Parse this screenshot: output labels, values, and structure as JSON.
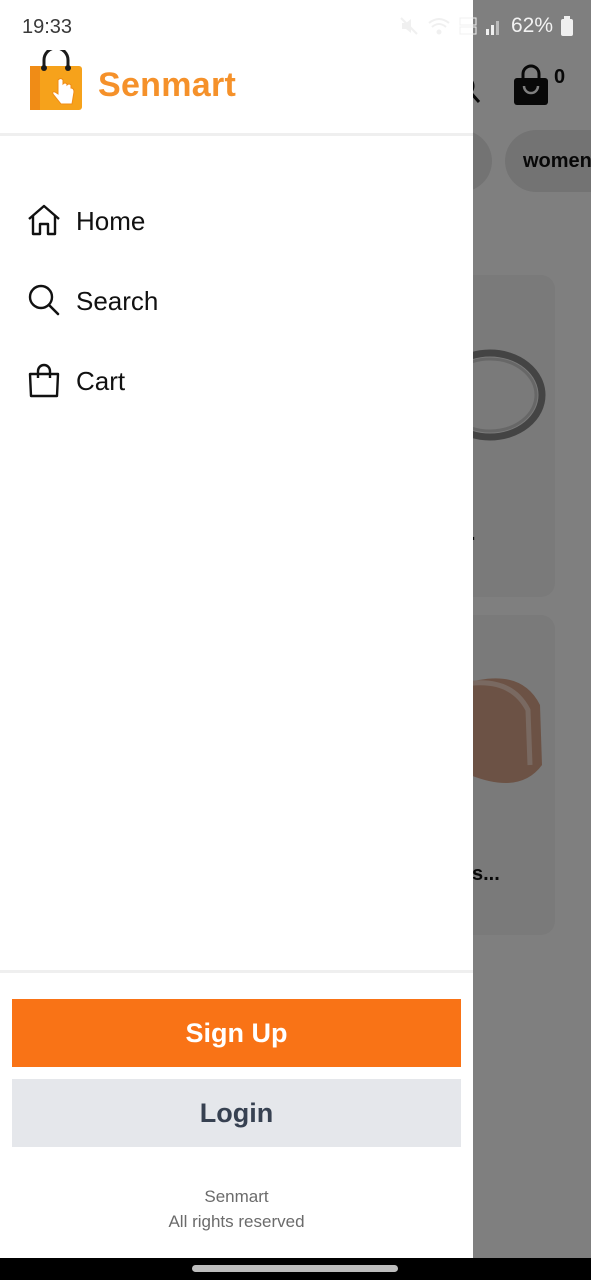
{
  "status_bar": {
    "time": "19:33",
    "battery_percent": "62%",
    "icons": [
      "mute-icon",
      "wifi-icon",
      "volte-icon",
      "signal-icon",
      "battery-icon"
    ]
  },
  "drawer": {
    "brand": {
      "name": "Senmart",
      "color": "#f5912a"
    },
    "nav": [
      {
        "label": "Home",
        "icon": "home-icon"
      },
      {
        "label": "Search",
        "icon": "search-icon"
      },
      {
        "label": "Cart",
        "icon": "shopping-bag-icon"
      }
    ],
    "signup_label": "Sign Up",
    "login_label": "Login",
    "footer_line1": "Senmart",
    "footer_line2": "All rights reserved",
    "signup_color": "#f97316"
  },
  "background": {
    "cart_count": "0",
    "chips": [
      "women"
    ],
    "product_titles": [
      ".",
      "s..."
    ]
  }
}
